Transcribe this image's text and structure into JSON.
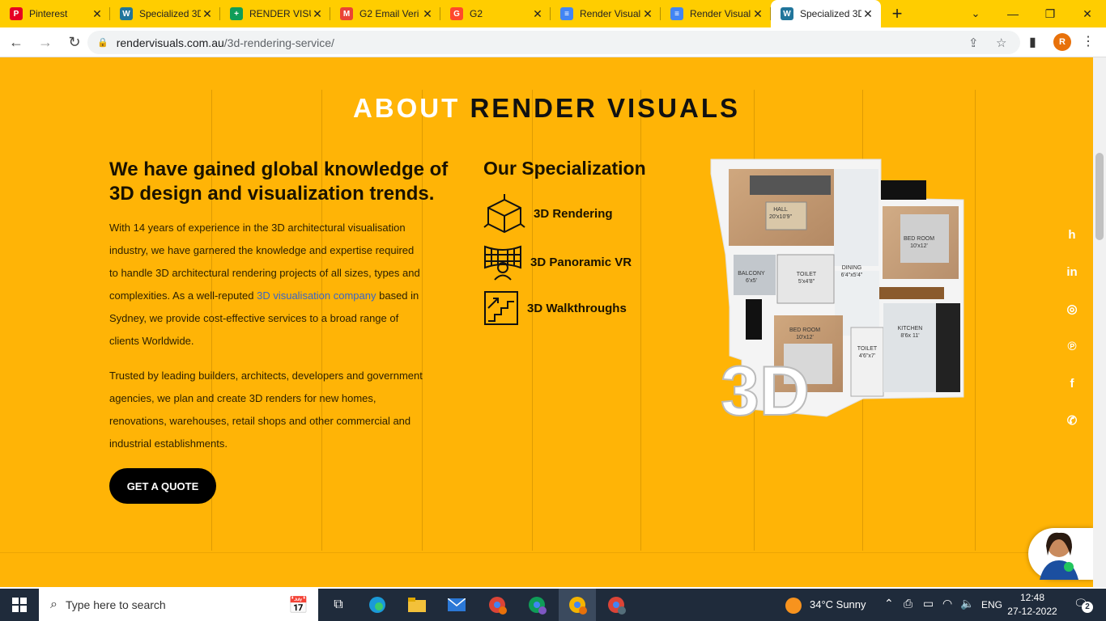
{
  "browser": {
    "tabs": [
      {
        "title": "Pinterest",
        "icon": "pinterest-icon",
        "color": "#e60023",
        "glyph": "P"
      },
      {
        "title": "Specialized 3D",
        "icon": "wordpress-icon",
        "color": "#21759b",
        "glyph": "W"
      },
      {
        "title": "RENDER VISU",
        "icon": "sheets-icon",
        "color": "#0f9d58",
        "glyph": "+"
      },
      {
        "title": "G2 Email Veri",
        "icon": "gmail-icon",
        "color": "#ea4335",
        "glyph": "M"
      },
      {
        "title": "G2",
        "icon": "g2-icon",
        "color": "#ff492c",
        "glyph": "G"
      },
      {
        "title": "Render Visual",
        "icon": "docs-icon",
        "color": "#4285f4",
        "glyph": "≡"
      },
      {
        "title": "Render Visual",
        "icon": "docs-icon",
        "color": "#4285f4",
        "glyph": "≡"
      },
      {
        "title": "Specialized 3D",
        "icon": "wordpress-icon",
        "color": "#21759b",
        "glyph": "W",
        "active": true
      }
    ],
    "url_host": "rendervisuals.com.au",
    "url_path": "/3d-rendering-service/",
    "profile_initial": "R"
  },
  "page": {
    "heading_white": "ABOUT",
    "heading_dark": "RENDER VISUALS",
    "subheading": "We have gained global knowledge of 3D design and visualization trends.",
    "para1_pre": "With 14 years of experience in the 3D architectural visualisation industry, we have garnered the knowledge and expertise required to handle 3D architectural rendering projects of all sizes, types and complexities. As a well-reputed ",
    "para1_link": "3D visualisation company",
    "para1_post": " based in Sydney, we provide cost-effective services to a broad range of clients Worldwide.",
    "para2": "Trusted by leading builders, architects, developers and government agencies, we plan and create 3D renders for new homes, renovations, warehouses, retail shops and other commercial and industrial establishments.",
    "cta": "GET A QUOTE",
    "spec_title": "Our Specialization",
    "specs": [
      "3D Rendering",
      "3D Panoramic VR",
      "3D Walkthroughs"
    ],
    "plan_labels": {
      "hall": "HALL",
      "hall_size": "20'x10'9\"",
      "bed1": "BED ROOM",
      "bed1_size": "10'x12'",
      "balcony": "BALCONY",
      "balcony_size": "6'x5'",
      "toilet1": "TOILET",
      "toilet1_size": "5'x4'8\"",
      "dining": "DINING",
      "dining_size": "6'4\"x5'4\"",
      "bed2": "BED ROOM",
      "bed2_size": "10'x12'",
      "kitchen": "KITCHEN",
      "kitchen_size": "8'6x 11'",
      "toilet2": "TOILET",
      "toilet2_size": "4'6\"x7'",
      "big3d": "3D"
    },
    "social": [
      "houzz-icon",
      "linkedin-icon",
      "instagram-icon",
      "pinterest-icon",
      "facebook-icon",
      "phone-icon"
    ]
  },
  "taskbar": {
    "search_placeholder": "Type here to search",
    "weather": "34°C  Sunny",
    "lang": "ENG",
    "time": "12:48",
    "date": "27-12-2022",
    "notif_count": "2"
  }
}
